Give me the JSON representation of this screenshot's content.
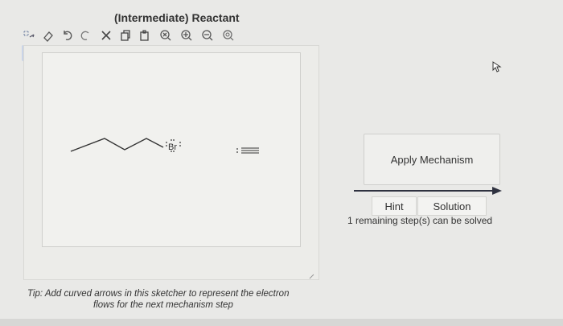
{
  "title": "(Intermediate) Reactant",
  "toolbar": {
    "icons": [
      "arrow-add-icon",
      "eraser-icon",
      "undo-icon",
      "redo-icon",
      "cut-icon",
      "copy-icon",
      "paste-icon",
      "zoom-reset-icon",
      "zoom-in-icon",
      "zoom-out-icon",
      "zoom-fit-icon"
    ]
  },
  "molecule": {
    "bromine_label": "Br"
  },
  "tip": {
    "line1": "Tip: Add curved arrows in this sketcher to represent the electron",
    "line2": "flows for the next mechanism step"
  },
  "actions": {
    "apply_label": "Apply Mechanism",
    "hint_label": "Hint",
    "solution_label": "Solution",
    "remaining_text": "1 remaining step(s) can be solved"
  },
  "colors": {
    "accent": "#c9d4e8",
    "arrow": "#2f3240"
  }
}
